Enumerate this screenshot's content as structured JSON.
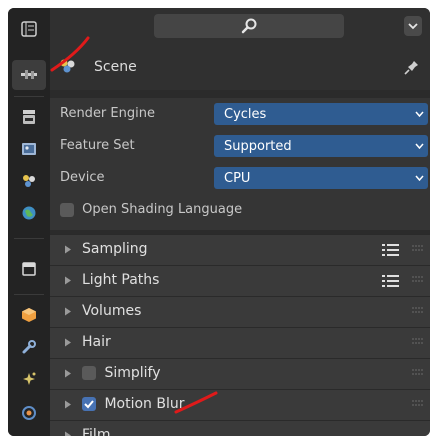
{
  "header": {
    "search_placeholder": ""
  },
  "context": {
    "label": "Scene"
  },
  "properties": [
    {
      "label": "Render Engine",
      "value": "Cycles"
    },
    {
      "label": "Feature Set",
      "value": "Supported"
    },
    {
      "label": "Device",
      "value": "CPU"
    }
  ],
  "osl": {
    "label": "Open Shading Language",
    "checked": false
  },
  "panels": [
    {
      "label": "Sampling",
      "presets": true
    },
    {
      "label": "Light Paths",
      "presets": true
    },
    {
      "label": "Volumes"
    },
    {
      "label": "Hair"
    },
    {
      "label": "Simplify",
      "checkbox": false
    },
    {
      "label": "Motion Blur",
      "checkbox": true
    },
    {
      "label": "Film"
    }
  ],
  "colors": {
    "accent": "#2f5c91",
    "checkbox_on": "#4772b3",
    "annotation": "#e01a1a"
  }
}
